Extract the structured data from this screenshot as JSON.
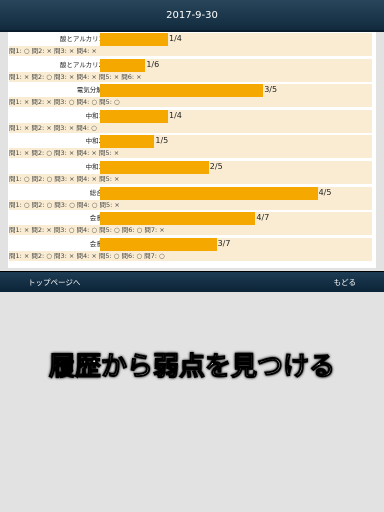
{
  "header": {
    "title": "2017-9-30"
  },
  "rows": [
    {
      "label": "酸とアルカリ1:",
      "ratio": "1/4",
      "value": 0.25,
      "detail": "問1: ○ 問2: × 問3: × 問4: ×"
    },
    {
      "label": "酸とアルカリ2:",
      "ratio": "1/6",
      "value": 0.1667,
      "detail": "問1: × 問2: ○ 問3: × 問4: × 問5: × 問6: ×"
    },
    {
      "label": "電気分解:",
      "ratio": "3/5",
      "value": 0.6,
      "detail": "問1: × 問2: × 問3: ○ 問4: ○ 問5: ○"
    },
    {
      "label": "中和1:",
      "ratio": "1/4",
      "value": 0.25,
      "detail": "問1: × 問2: × 問3: × 問4: ○"
    },
    {
      "label": "中和2:",
      "ratio": "1/5",
      "value": 0.2,
      "detail": "問1: × 問2: ○ 問3: × 問4: × 問5: ×"
    },
    {
      "label": "中和3:",
      "ratio": "2/5",
      "value": 0.4,
      "detail": "問1: ○ 問2: ○ 問3: × 問4: × 問5: ×"
    },
    {
      "label": "総合:",
      "ratio": "4/5",
      "value": 0.8,
      "detail": "問1: ○ 問2: ○ 問3: ○ 問4: ○ 問5: ×"
    },
    {
      "label": "会意:",
      "ratio": "4/7",
      "value": 0.5714,
      "detail": "問1: × 問2: × 問3: ○ 問4: ○ 問5: ○ 問6: ○ 問7: ×"
    },
    {
      "label": "会意:",
      "ratio": "3/7",
      "value": 0.4286,
      "detail": "問1: × 問2: ○ 問3: × 問4: × 問5: ○ 問6: ○ 問7: ○"
    }
  ],
  "footer": {
    "back_label": "トップページへ",
    "return_label": "もどる"
  },
  "caption": "履歴から弱点を見つける",
  "colors": {
    "bar": "#f5a800",
    "track": "#f9ecd2",
    "header": "#1a3a50"
  }
}
